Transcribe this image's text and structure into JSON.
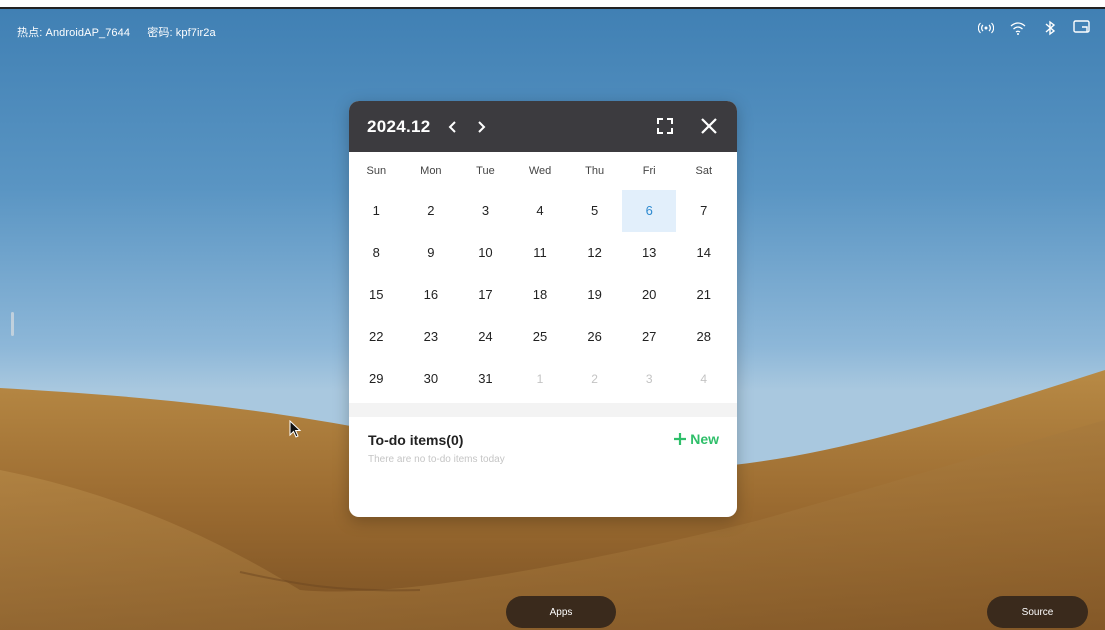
{
  "status": {
    "hotspot": "热点: AndroidAP_7644",
    "password": "密码: kpf7ir2a"
  },
  "system_icons": [
    "hotspot-icon",
    "wifi-icon",
    "bluetooth-icon",
    "screen-share-icon"
  ],
  "calendar": {
    "title": "2024.12",
    "prev_label": "‹",
    "next_label": "›",
    "weekdays": [
      "Sun",
      "Mon",
      "Tue",
      "Wed",
      "Thu",
      "Fri",
      "Sat"
    ],
    "weeks": [
      [
        "1",
        "2",
        "3",
        "4",
        "5",
        "6",
        "7"
      ],
      [
        "8",
        "9",
        "10",
        "11",
        "12",
        "13",
        "14"
      ],
      [
        "15",
        "16",
        "17",
        "18",
        "19",
        "20",
        "21"
      ],
      [
        "22",
        "23",
        "24",
        "25",
        "26",
        "27",
        "28"
      ],
      [
        "29",
        "30",
        "31",
        "1",
        "2",
        "3",
        "4"
      ]
    ],
    "today": "6",
    "todo_title": "To-do items(0)",
    "todo_new": "New",
    "todo_empty": "There are no to-do items today"
  },
  "dock": {
    "apps": "Apps",
    "source": "Source"
  },
  "colors": {
    "accent_today": "#2e8ad0",
    "new_green": "#2fbf6a",
    "header_bg": "#3c3b3f"
  }
}
